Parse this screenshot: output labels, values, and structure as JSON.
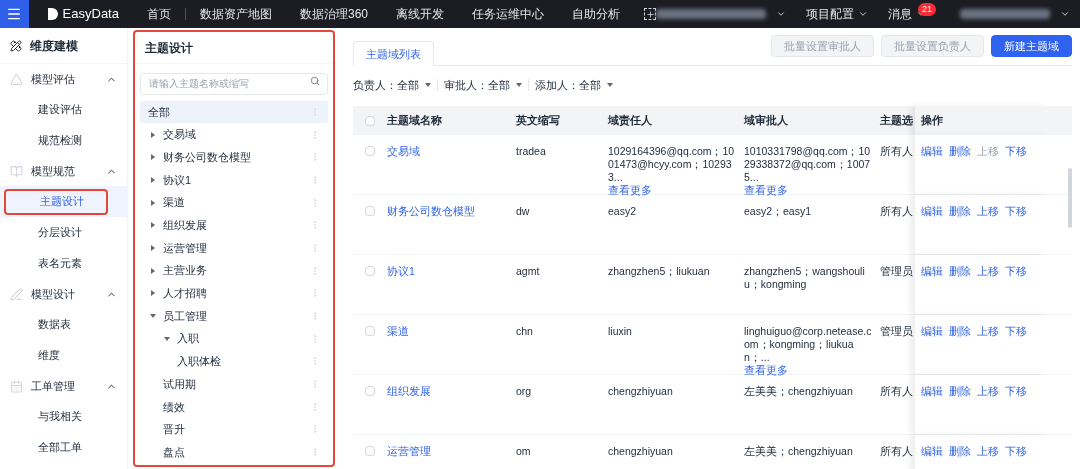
{
  "topbar": {
    "logo": "EasyData",
    "nav": [
      {
        "label": "首页",
        "selected": false
      },
      {
        "label": "数据资产地图",
        "selected": false
      },
      {
        "label": "数据治理360",
        "selected": false
      },
      {
        "label": "离线开发",
        "selected": false
      },
      {
        "label": "任务运维中心",
        "selected": false
      },
      {
        "label": "自助分析",
        "selected": false
      }
    ],
    "menus": [
      {
        "label": "项目配置"
      },
      {
        "label": "消息",
        "badge": "21"
      }
    ]
  },
  "sidebar": {
    "title": "维度建模",
    "groups": [
      {
        "label": "模型评估",
        "expanded": true,
        "items": [
          {
            "label": "建设评估",
            "selected": false
          },
          {
            "label": "规范检测",
            "selected": false
          }
        ]
      },
      {
        "label": "模型规范",
        "expanded": true,
        "items": [
          {
            "label": "主题设计",
            "selected": true
          },
          {
            "label": "分层设计",
            "selected": false
          },
          {
            "label": "表名元素",
            "selected": false
          }
        ]
      },
      {
        "label": "模型设计",
        "expanded": true,
        "items": [
          {
            "label": "数据表",
            "selected": false
          },
          {
            "label": "维度",
            "selected": false
          }
        ]
      },
      {
        "label": "工单管理",
        "expanded": true,
        "items": [
          {
            "label": "与我相关",
            "selected": false
          },
          {
            "label": "全部工单",
            "selected": false
          }
        ]
      }
    ]
  },
  "tree_panel": {
    "title": "主题设计",
    "search": {
      "placeholder": "请输入主题名称或缩写"
    },
    "all": {
      "label": "全部",
      "selected": true
    },
    "items": [
      {
        "label": "交易域",
        "selected": false,
        "expanded": false
      },
      {
        "label": "财务公司数仓模型",
        "selected": false,
        "expanded": false
      },
      {
        "label": "协议1",
        "selected": false,
        "expanded": false
      },
      {
        "label": "渠道",
        "selected": false,
        "expanded": false
      },
      {
        "label": "组织发展",
        "selected": false,
        "expanded": false
      },
      {
        "label": "运营管理",
        "selected": false,
        "expanded": false
      },
      {
        "label": "主营业务",
        "selected": false,
        "expanded": false
      },
      {
        "label": "人才招聘",
        "selected": false,
        "expanded": false
      },
      {
        "label": "员工管理",
        "selected": false,
        "expanded": true,
        "children": [
          {
            "label": "入职",
            "selected": false,
            "expanded": true
          },
          {
            "label": "入职体检",
            "selected": false
          }
        ]
      },
      {
        "label": "试用期",
        "selected": false
      },
      {
        "label": "绩效",
        "selected": false
      },
      {
        "label": "晋升",
        "selected": false
      },
      {
        "label": "盘点",
        "selected": false
      }
    ]
  },
  "main": {
    "tabs": [
      {
        "label": "主题域列表",
        "selected": true
      }
    ],
    "buttons": [
      {
        "label": "批量设置审批人",
        "kind": "secondary",
        "disabled": true
      },
      {
        "label": "批量设置负责人",
        "kind": "secondary",
        "disabled": true
      },
      {
        "label": "新建主题域",
        "kind": "primary",
        "disabled": false
      }
    ],
    "filters": [
      {
        "label": "负责人：",
        "value": "全部"
      },
      {
        "label": "审批人：",
        "value": "全部"
      },
      {
        "label": "添加人：",
        "value": "全部"
      }
    ],
    "table": {
      "all_checked": false,
      "columns": [
        "主题域名称",
        "英文缩写",
        "域责任人",
        "域审批人",
        "主题选",
        "操作"
      ],
      "rows": [
        {
          "checked": false,
          "name": "交易域",
          "abbr": "tradea",
          "owner": "1029164396@qq.com；1001473@hcyy.com；102933...",
          "owner_more": "查看更多",
          "approver": "1010331798@qq.com；1029338372@qq.com；10075...",
          "approver_more": "查看更多",
          "choice": "所有人",
          "actions": [
            {
              "label": "编辑",
              "disabled": false
            },
            {
              "label": "删除",
              "disabled": false
            },
            {
              "label": "上移",
              "disabled": true
            },
            {
              "label": "下移",
              "disabled": false
            }
          ]
        },
        {
          "checked": false,
          "name": "财务公司数仓模型",
          "abbr": "dw",
          "owner": "easy2",
          "approver": "easy2；easy1",
          "choice": "所有人",
          "actions": [
            {
              "label": "编辑",
              "disabled": false
            },
            {
              "label": "删除",
              "disabled": false
            },
            {
              "label": "上移",
              "disabled": false
            },
            {
              "label": "下移",
              "disabled": false
            }
          ]
        },
        {
          "checked": false,
          "name": "协议1",
          "abbr": "agmt",
          "owner": "zhangzhen5；liukuan",
          "approver": "zhangzhen5；wangshouliu；kongming",
          "choice": "管理员",
          "actions": [
            {
              "label": "编辑",
              "disabled": false
            },
            {
              "label": "删除",
              "disabled": false
            },
            {
              "label": "上移",
              "disabled": false
            },
            {
              "label": "下移",
              "disabled": false
            }
          ]
        },
        {
          "checked": false,
          "name": "渠道",
          "abbr": "chn",
          "owner": "liuxin",
          "approver": "linghuiguo@corp.netease.com；kongming；liukuan；...",
          "approver_more": "查看更多",
          "choice": "管理员",
          "actions": [
            {
              "label": "编辑",
              "disabled": false
            },
            {
              "label": "删除",
              "disabled": false
            },
            {
              "label": "上移",
              "disabled": false
            },
            {
              "label": "下移",
              "disabled": false
            }
          ]
        },
        {
          "checked": false,
          "name": "组织发展",
          "abbr": "org",
          "owner": "chengzhiyuan",
          "approver": "左美美；chengzhiyuan",
          "choice": "所有人",
          "actions": [
            {
              "label": "编辑",
              "disabled": false
            },
            {
              "label": "删除",
              "disabled": false
            },
            {
              "label": "上移",
              "disabled": false
            },
            {
              "label": "下移",
              "disabled": false
            }
          ]
        },
        {
          "checked": false,
          "name": "运营管理",
          "abbr": "om",
          "owner": "chengzhiyuan",
          "approver": "左美美；chengzhiyuan",
          "choice": "所有人",
          "actions": [
            {
              "label": "编辑",
              "disabled": false
            },
            {
              "label": "删除",
              "disabled": false
            },
            {
              "label": "上移",
              "disabled": false
            },
            {
              "label": "下移",
              "disabled": false
            }
          ]
        }
      ]
    }
  }
}
